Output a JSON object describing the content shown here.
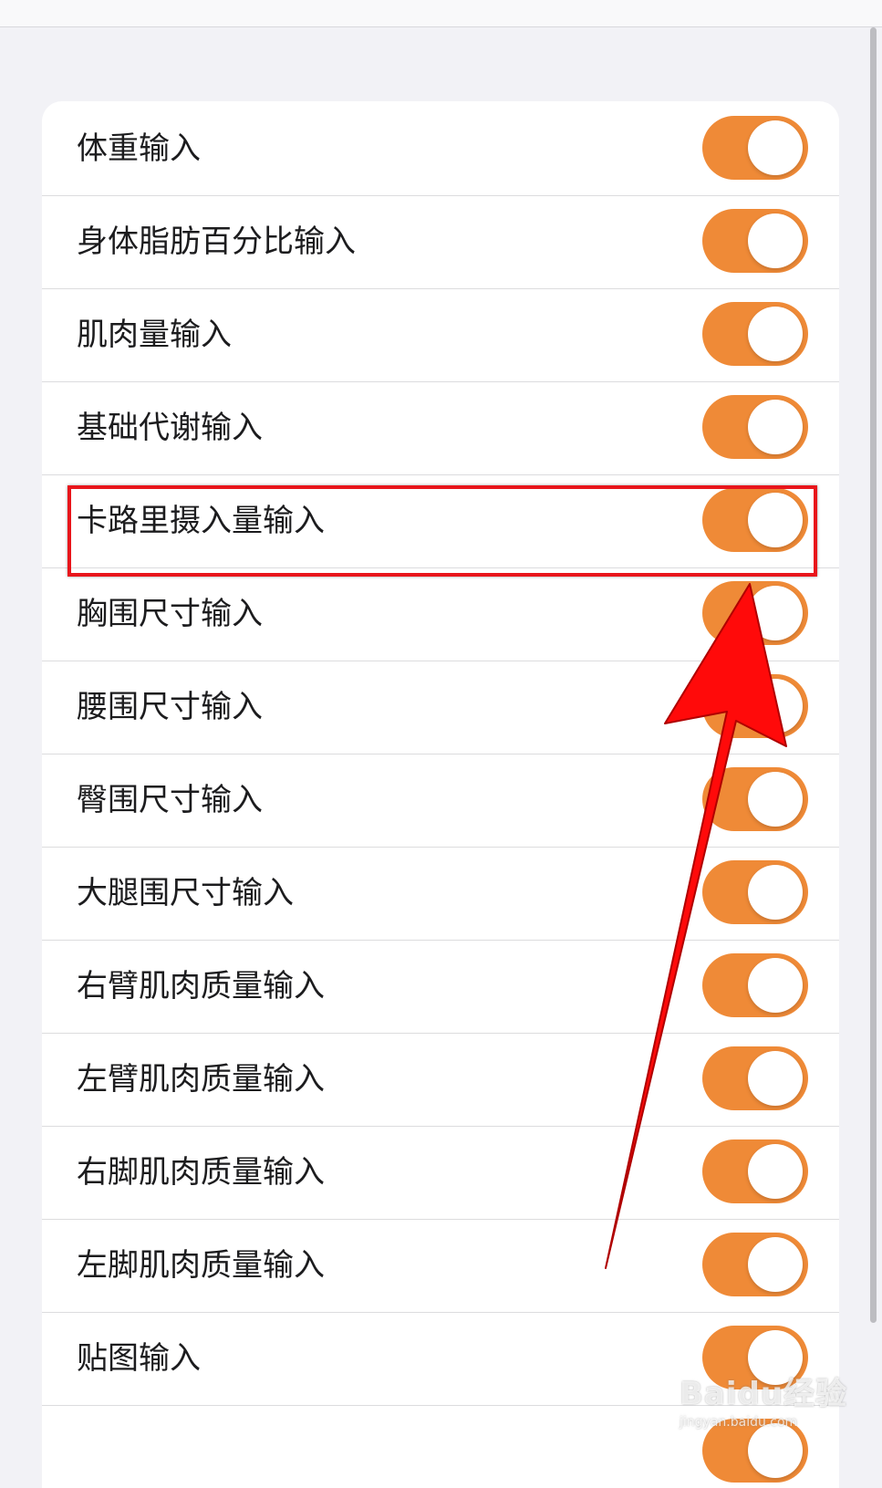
{
  "settings": {
    "items": [
      {
        "label": "体重输入",
        "enabled": true
      },
      {
        "label": "身体脂肪百分比输入",
        "enabled": true
      },
      {
        "label": "肌肉量输入",
        "enabled": true
      },
      {
        "label": "基础代谢输入",
        "enabled": true
      },
      {
        "label": "卡路里摄入量输入",
        "enabled": true
      },
      {
        "label": "胸围尺寸输入",
        "enabled": true
      },
      {
        "label": "腰围尺寸输入",
        "enabled": true
      },
      {
        "label": "臀围尺寸输入",
        "enabled": true
      },
      {
        "label": "大腿围尺寸输入",
        "enabled": true
      },
      {
        "label": "右臂肌肉质量输入",
        "enabled": true
      },
      {
        "label": "左臂肌肉质量输入",
        "enabled": true
      },
      {
        "label": "右脚肌肉质量输入",
        "enabled": true
      },
      {
        "label": "左脚肌肉质量输入",
        "enabled": true
      },
      {
        "label": "贴图输入",
        "enabled": true
      },
      {
        "label": "",
        "enabled": true
      }
    ]
  },
  "annotation": {
    "highlighted_item": "卡路里摄入量输入",
    "highlight_color": "#e8151b",
    "arrow_color": "#ff0000"
  },
  "watermark": {
    "brand": "Baidu经验",
    "url": "jingyan.baidu.com"
  },
  "colors": {
    "toggle_on": "#ef8a37",
    "background": "#f2f2f6"
  }
}
